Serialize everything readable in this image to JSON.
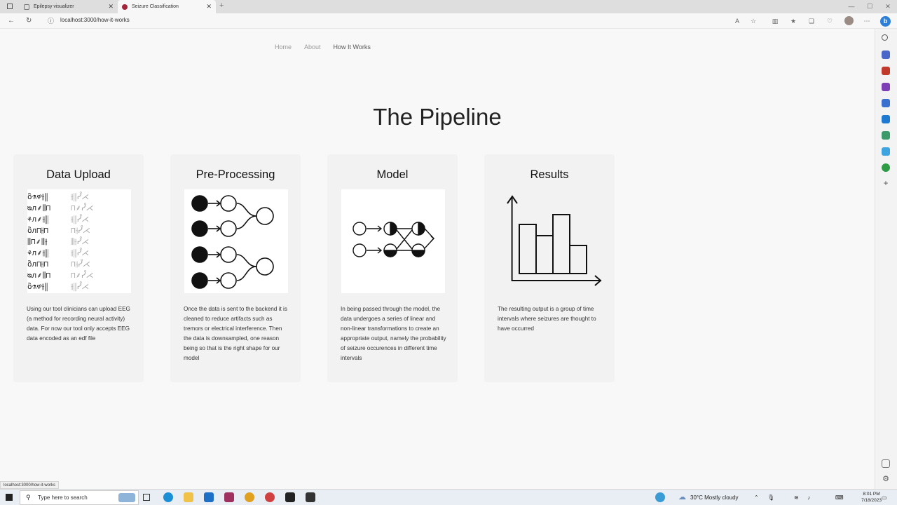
{
  "browser": {
    "tabs": [
      {
        "title": "Epilepsy visualizer",
        "active": false
      },
      {
        "title": "Seizure Classification",
        "active": true
      }
    ],
    "url": "localhost:3000/how-it-works",
    "status_url": "localhost:3000/how-it-works"
  },
  "nav": {
    "links": [
      "Home",
      "About",
      "How It Works"
    ]
  },
  "page": {
    "title": "The Pipeline"
  },
  "cards": [
    {
      "title": "Data Upload",
      "text": "Using our tool clinicians can upload EEG (a method for recording neural activity) data. For now our tool only accepts EEG data encoded as an edf file",
      "icon": "eeg-data-icon"
    },
    {
      "title": "Pre-Processing",
      "text": "Once the data is sent to the backend it is cleaned to reduce artifacts such as tremors or electrical interference. Then the data is downsampled, one reason being so that is the right shape for our model",
      "icon": "preprocessing-icon"
    },
    {
      "title": "Model",
      "text": "In being passed through the model, the data undergoes a series of linear and non-linear transformations to create an appropriate output, namely the probability of seizure occurences in different time intervals",
      "icon": "neural-network-icon"
    },
    {
      "title": "Results",
      "text": "The resulting output is a group of time intervals where seizures are thought to have occurred",
      "icon": "bar-chart-icon"
    }
  ],
  "taskbar": {
    "search_placeholder": "Type here to search",
    "weather": "30°C  Mostly cloudy",
    "time": "8:01 PM",
    "date": "7/18/2023"
  }
}
